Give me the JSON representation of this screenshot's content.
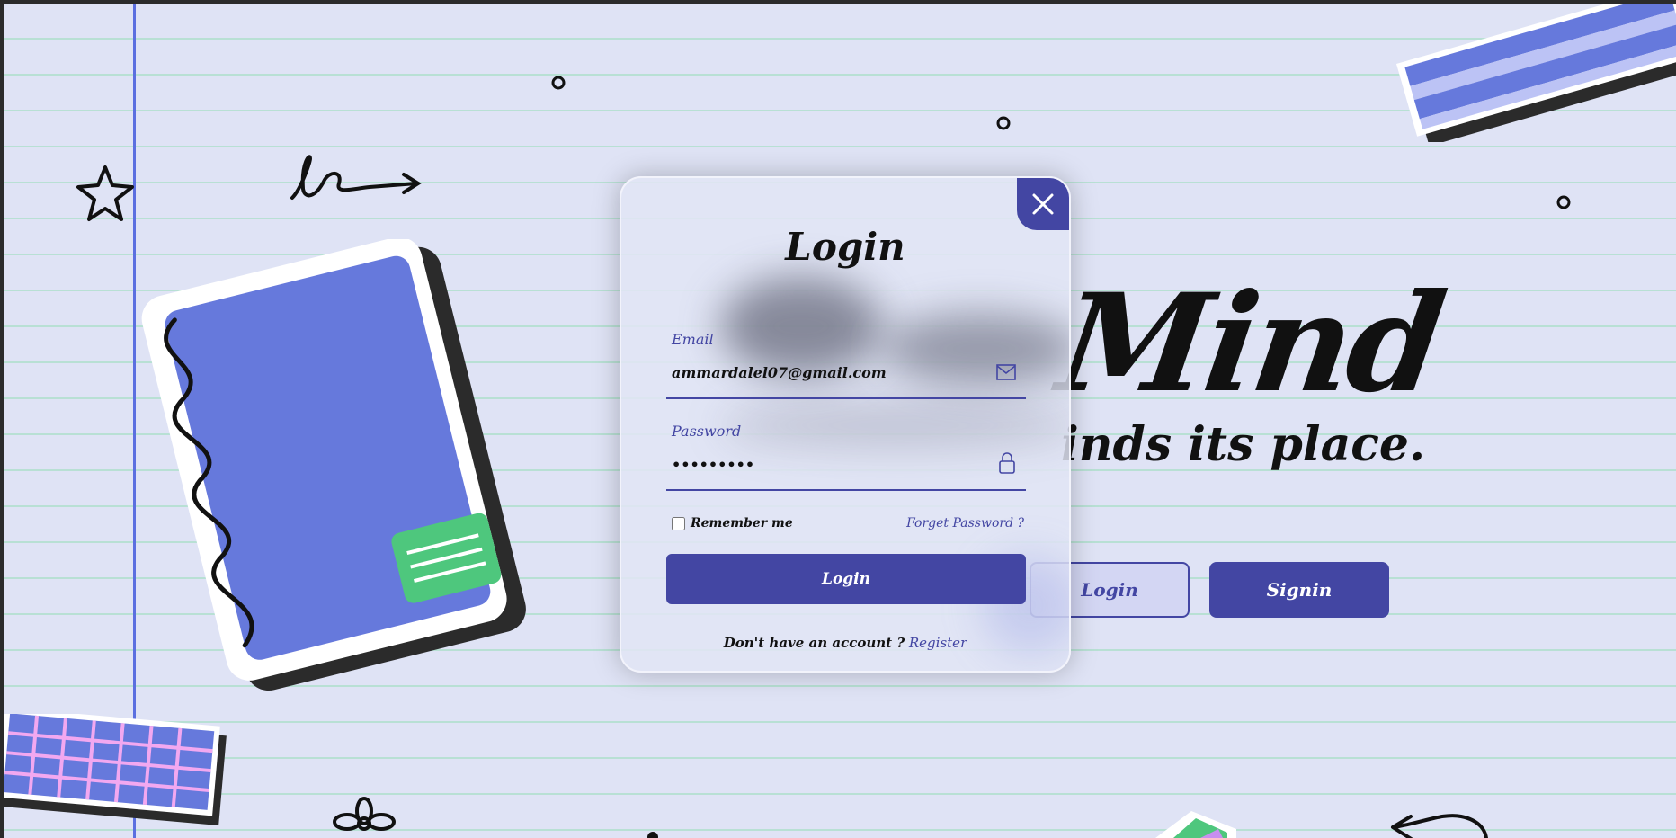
{
  "hero": {
    "title": "Mind",
    "subtitle": "inds its place.",
    "login_label": "Login",
    "signin_label": "Signin"
  },
  "modal": {
    "title": "Login",
    "email": {
      "label": "Email",
      "value": "ammardalel07@gmail.com",
      "icon": "mail-icon"
    },
    "password": {
      "label": "Password",
      "value": "•••••••••",
      "icon": "lock-icon"
    },
    "remember_label": "Remember me",
    "forgot_label": "Forget Password ?",
    "submit_label": "Login",
    "register_prompt": "Don't have an account ?",
    "register_link": "Register"
  },
  "colors": {
    "background": "#dfe3f5",
    "accent": "#4346a3",
    "notebook_blue": "#6679dc",
    "green": "#4ec77d"
  }
}
